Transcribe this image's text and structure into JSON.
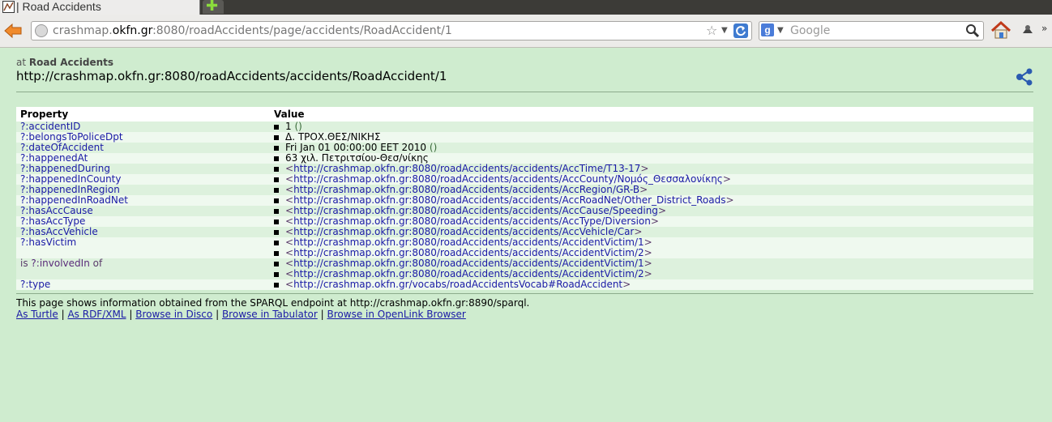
{
  "browser": {
    "tab_title": "Road Accidents",
    "url_prefix": "crashmap.",
    "url_domain": "okfn.gr",
    "url_rest": ":8080/roadAccidents/page/accidents/RoadAccident/1",
    "search_placeholder": "Google"
  },
  "page": {
    "at_prefix": "at",
    "site_name": "Road Accidents",
    "resource_uri": "http://crashmap.okfn.gr:8080/roadAccidents/accidents/RoadAccident/1"
  },
  "table": {
    "header_property": "Property",
    "header_value": "Value",
    "rows": [
      {
        "prefix": "",
        "property": "?:accidentID",
        "suffix": "",
        "values": [
          {
            "text": "1",
            "datatype": "()"
          }
        ]
      },
      {
        "prefix": "",
        "property": "?:belongsToPoliceDpt",
        "suffix": "",
        "values": [
          {
            "text": "Δ. ΤΡΟΧ.ΘΕΣ/ΝΙΚΗΣ"
          }
        ]
      },
      {
        "prefix": "",
        "property": "?:dateOfAccident",
        "suffix": "",
        "values": [
          {
            "text": "Fri Jan 01 00:00:00 EET 2010",
            "datatype": "()"
          }
        ]
      },
      {
        "prefix": "",
        "property": "?:happenedAt",
        "suffix": "",
        "values": [
          {
            "text": "63 χιλ. Πετριτσίου-Θεσ/νίκης"
          }
        ]
      },
      {
        "prefix": "",
        "property": "?:happenedDuring",
        "suffix": "",
        "values": [
          {
            "link": "http://crashmap.okfn.gr:8080/roadAccidents/accidents/AccTime/T13-17"
          }
        ]
      },
      {
        "prefix": "",
        "property": "?:happenedInCounty",
        "suffix": "",
        "values": [
          {
            "link": "http://crashmap.okfn.gr:8080/roadAccidents/accidents/AccCounty/Νομός_Θεσσαλονίκης"
          }
        ]
      },
      {
        "prefix": "",
        "property": "?:happenedInRegion",
        "suffix": "",
        "values": [
          {
            "link": "http://crashmap.okfn.gr:8080/roadAccidents/accidents/AccRegion/GR-B"
          }
        ]
      },
      {
        "prefix": "",
        "property": "?:happenedInRoadNet",
        "suffix": "",
        "values": [
          {
            "link": "http://crashmap.okfn.gr:8080/roadAccidents/accidents/AccRoadNet/Other_District_Roads"
          }
        ]
      },
      {
        "prefix": "",
        "property": "?:hasAccCause",
        "suffix": "",
        "values": [
          {
            "link": "http://crashmap.okfn.gr:8080/roadAccidents/accidents/AccCause/Speeding"
          }
        ]
      },
      {
        "prefix": "",
        "property": "?:hasAccType",
        "suffix": "",
        "values": [
          {
            "link": "http://crashmap.okfn.gr:8080/roadAccidents/accidents/AccType/Diversion"
          }
        ]
      },
      {
        "prefix": "",
        "property": "?:hasAccVehicle",
        "suffix": "",
        "values": [
          {
            "link": "http://crashmap.okfn.gr:8080/roadAccidents/accidents/AccVehicle/Car"
          }
        ]
      },
      {
        "prefix": "",
        "property": "?:hasVictim",
        "suffix": "",
        "values": [
          {
            "link": "http://crashmap.okfn.gr:8080/roadAccidents/accidents/AccidentVictim/1"
          },
          {
            "link": "http://crashmap.okfn.gr:8080/roadAccidents/accidents/AccidentVictim/2"
          }
        ]
      },
      {
        "prefix": "is",
        "property": "?:involvedIn",
        "suffix": "of",
        "values": [
          {
            "link": "http://crashmap.okfn.gr:8080/roadAccidents/accidents/AccidentVictim/1"
          },
          {
            "link": "http://crashmap.okfn.gr:8080/roadAccidents/accidents/AccidentVictim/2"
          }
        ]
      },
      {
        "prefix": "",
        "property": "?:type",
        "suffix": "",
        "values": [
          {
            "link": "http://crashmap.okfn.gr/vocabs/roadAccidentsVocab#RoadAccident"
          }
        ]
      }
    ]
  },
  "footer": {
    "note": "This page shows information obtained from the SPARQL endpoint at http://crashmap.okfn.gr:8890/sparql.",
    "links": [
      "As Turtle",
      "As RDF/XML",
      "Browse in Disco",
      "Browse in Tabulator",
      "Browse in OpenLink Browser"
    ],
    "separator": "|"
  },
  "colors": {
    "page_bg": "#cfeccf",
    "row_even": "#ddf1dd",
    "row_odd": "#eff9ef",
    "link": "#1a1aa6",
    "visited": "#5a2b7a"
  },
  "icons": [
    "page-favicon-icon",
    "new-tab-icon",
    "back-arrow-icon",
    "site-identity-icon",
    "bookmark-star-icon",
    "reload-icon",
    "google-engine-icon",
    "search-icon",
    "home-icon",
    "addon-icon",
    "share-graph-icon"
  ]
}
